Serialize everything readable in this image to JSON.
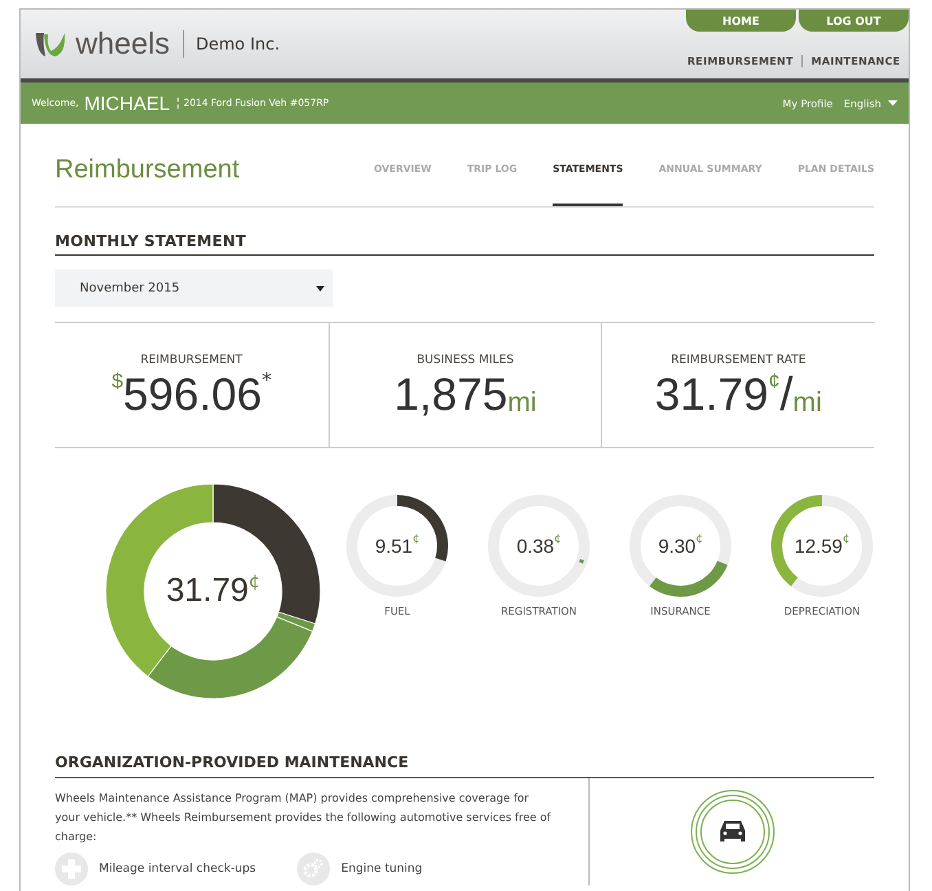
{
  "header": {
    "logo": "wheels",
    "company": "Demo Inc.",
    "top_buttons": [
      "HOME",
      "LOG OUT"
    ],
    "nav": [
      "REIMBURSEMENT",
      "MAINTENANCE"
    ]
  },
  "user_bar": {
    "welcome": "Welcome,",
    "name": "MICHAEL",
    "vehicle": "2014 Ford Fusion Veh #057RP",
    "profile": "My Profile",
    "language": "English"
  },
  "page": {
    "title": "Reimbursement",
    "tabs": [
      {
        "label": "OVERVIEW",
        "selected": false
      },
      {
        "label": "TRIP LOG",
        "selected": false
      },
      {
        "label": "STATEMENTS",
        "selected": true
      },
      {
        "label": "ANNUAL SUMMARY",
        "selected": false
      },
      {
        "label": "PLAN DETAILS",
        "selected": false
      }
    ]
  },
  "statement": {
    "heading": "MONTHLY STATEMENT",
    "month_select": {
      "value": "November 2015"
    },
    "stats": [
      {
        "label": "REIMBURSEMENT",
        "parts": [
          {
            "kind": "prefix",
            "text": "$"
          },
          {
            "kind": "main",
            "text": "596.06"
          },
          {
            "kind": "sup",
            "text": "*"
          }
        ]
      },
      {
        "label": "BUSINESS MILES",
        "parts": [
          {
            "kind": "main",
            "text": "1,875"
          },
          {
            "kind": "unit",
            "text": "mi"
          }
        ]
      },
      {
        "label": "REIMBURSEMENT RATE",
        "parts": [
          {
            "kind": "main",
            "text": "31.79"
          },
          {
            "kind": "prefix",
            "text": "¢"
          },
          {
            "kind": "slash",
            "text": "/"
          },
          {
            "kind": "unit",
            "text": "mi"
          }
        ]
      }
    ]
  },
  "breakdown": {
    "total": "31.79",
    "total_unit": "¢",
    "chart_data": {
      "type": "donut",
      "values": [
        29.9,
        1.2,
        29.3,
        39.6
      ]
    },
    "rings": [
      {
        "value": "9.51",
        "unit": "¢",
        "label": "FUEL",
        "color": "#3d3832"
      },
      {
        "value": "0.38",
        "unit": "¢",
        "label": "REGISTRATION",
        "color": "#6e9a48"
      },
      {
        "value": "9.30",
        "unit": "¢",
        "label": "INSURANCE",
        "color": "#6e9a48"
      },
      {
        "value": "12.59",
        "unit": "¢",
        "label": "DEPRECIATION",
        "color": "#8ab63f"
      }
    ]
  },
  "maintenance": {
    "heading": "ORGANIZATION-PROVIDED MAINTENANCE",
    "text": "Wheels Maintenance Assistance Program (MAP) provides comprehensive coverage for your vehicle.** Wheels Reimbursement provides the following automotive services free of charge:",
    "services": [
      {
        "kind": "plus",
        "label": "Mileage interval check-ups"
      },
      {
        "kind": "gears",
        "label": "Engine tuning"
      }
    ]
  }
}
